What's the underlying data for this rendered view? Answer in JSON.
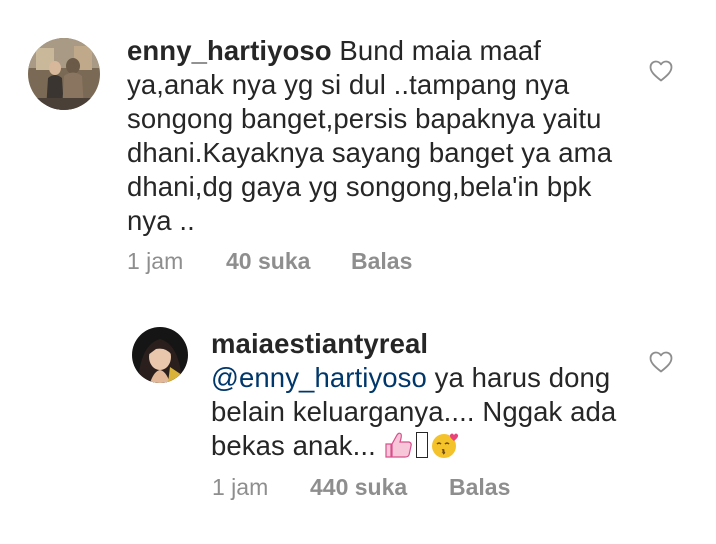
{
  "comments": [
    {
      "username": "enny_hartiyoso",
      "text": " Bund maia maaf ya,anak nya yg si dul ..tampang nya songong banget,persis bapaknya yaitu dhani.Kayaknya sayang banget ya ama dhani,dg gaya yg songong,bela'in bpk nya ..",
      "time": "1 jam",
      "likes": "40 suka",
      "reply_label": "Balas",
      "like_icon": "heart-outline-icon"
    },
    {
      "username": "maiaestiantyreal",
      "mention": "@enny_hartiyoso",
      "text": " ya harus dong belain keluarganya.... Nggak ada bekas anak...",
      "emoji_trailing": "👍🏻",
      "time": "1 jam",
      "likes": "440 suka",
      "reply_label": "Balas",
      "like_icon": "heart-outline-icon"
    }
  ],
  "colors": {
    "text": "#262626",
    "meta": "#8e8e8e",
    "mention": "#00376b",
    "icon": "#8e8e8e"
  }
}
